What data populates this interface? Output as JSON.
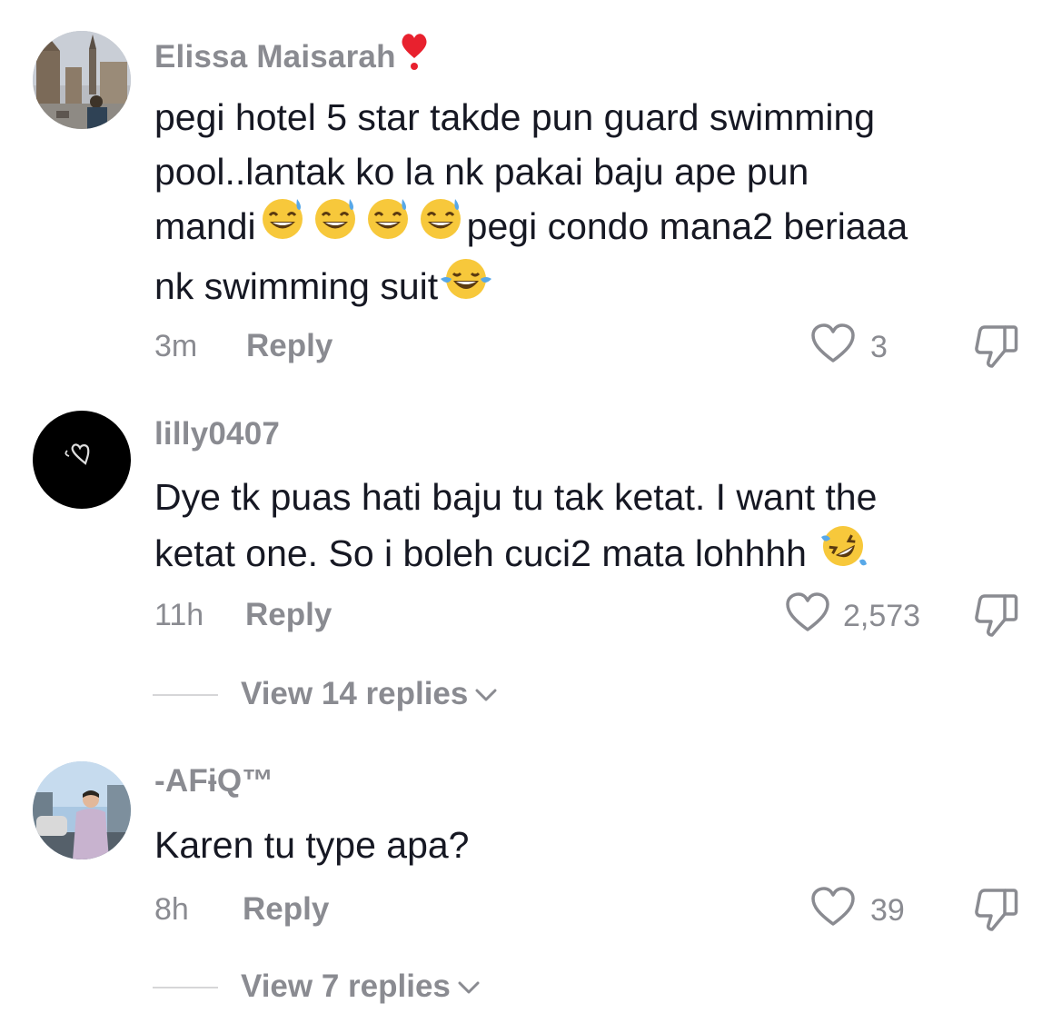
{
  "comments": [
    {
      "username": "Elissa Maisarah",
      "username_badge": "heart-exclamation-icon",
      "text_lines": [
        "pegi hotel 5 star takde pun guard swimming",
        "pool..lantak ko la nk pakai baju ape pun",
        "mandi",
        "pegi condo mana2 beriaaa",
        "nk swimming suit"
      ],
      "emojis": [
        "grinning-sweat-emoji",
        "tears-of-joy-emoji"
      ],
      "time": "3m",
      "reply_label": "Reply",
      "likes": "3"
    },
    {
      "username": "lilly0407",
      "text_lines": [
        "Dye tk puas hati baju tu tak ketat. I want the",
        "ketat one. So i boleh cuci2 mata lohhhh "
      ],
      "emojis": [
        "rolling-on-floor-laughing-emoji"
      ],
      "time": "11h",
      "reply_label": "Reply",
      "likes": "2,573",
      "view_replies": "View 14 replies"
    },
    {
      "username": "-AFɨQ™",
      "text_lines": [
        "Karen tu type apa?"
      ],
      "time": "8h",
      "reply_label": "Reply",
      "likes": "39",
      "view_replies": "View 7 replies"
    }
  ],
  "colors": {
    "primary_text": "#161823",
    "secondary_text": "#8a8b91",
    "badge_red": "#e8212e",
    "emoji_yellow": "#f7c83b"
  }
}
